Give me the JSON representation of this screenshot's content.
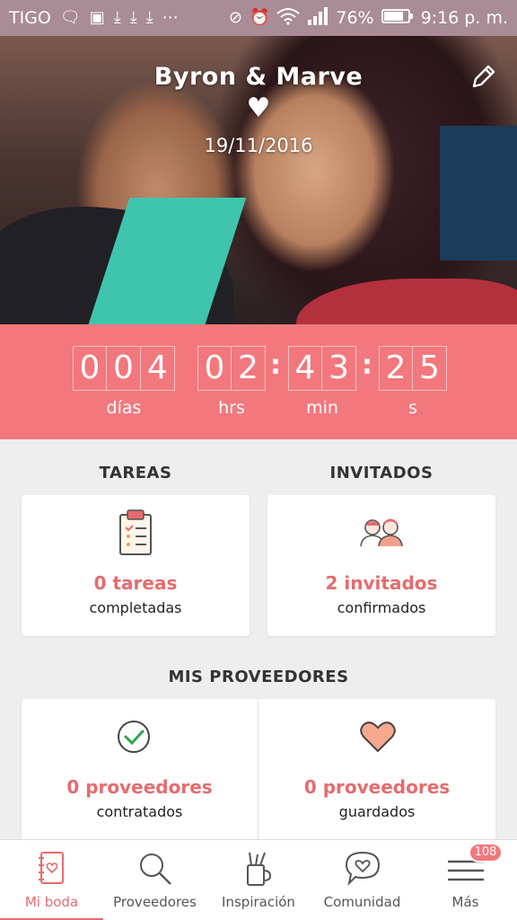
{
  "status_bar": {
    "carrier": "TIGO",
    "battery": "76%",
    "time": "9:16 p. m."
  },
  "hero": {
    "names": "Byron & Marve",
    "date": "19/11/2016"
  },
  "countdown": {
    "days_digits": [
      "0",
      "0",
      "4"
    ],
    "hours_digits": [
      "0",
      "2"
    ],
    "minutes_digits": [
      "4",
      "3"
    ],
    "seconds_digits": [
      "2",
      "5"
    ],
    "days_label": "días",
    "hours_label": "hrs",
    "minutes_label": "min",
    "seconds_label": "s"
  },
  "tasks": {
    "section_title": "TAREAS",
    "count_text": "0 tareas",
    "sub_text": "completadas"
  },
  "guests": {
    "section_title": "INVITADOS",
    "count_text": "2 invitados",
    "sub_text": "confirmados"
  },
  "vendors": {
    "section_title": "MIS PROVEEDORES",
    "hired_count": "0 proveedores",
    "hired_sub": "contratados",
    "saved_count": "0 proveedores",
    "saved_sub": "guardados"
  },
  "bottom_nav": {
    "items": [
      {
        "label": "Mi boda",
        "icon": "notebook-icon"
      },
      {
        "label": "Proveedores",
        "icon": "search-icon"
      },
      {
        "label": "Inspiración",
        "icon": "tools-cup-icon"
      },
      {
        "label": "Comunidad",
        "icon": "chat-heart-icon"
      },
      {
        "label": "Más",
        "icon": "menu-icon"
      }
    ],
    "badge_count": "108"
  },
  "colors": {
    "accent": "#f2787d",
    "accent_text": "#e66b6e",
    "status_bar": "#a98c96"
  }
}
